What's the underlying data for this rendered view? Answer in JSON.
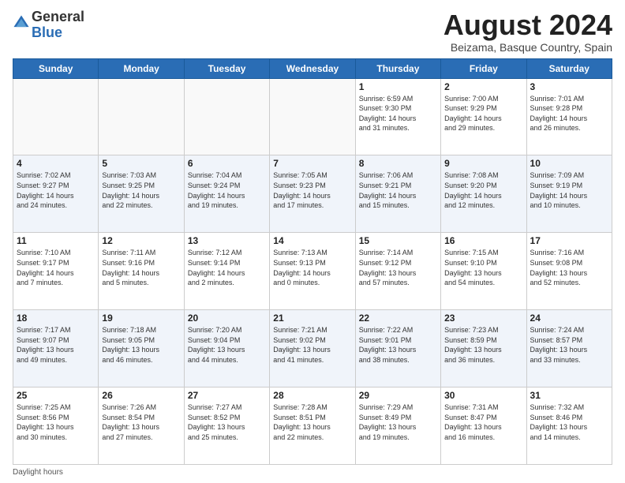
{
  "header": {
    "logo_general": "General",
    "logo_blue": "Blue",
    "month_year": "August 2024",
    "location": "Beizama, Basque Country, Spain"
  },
  "days_of_week": [
    "Sunday",
    "Monday",
    "Tuesday",
    "Wednesday",
    "Thursday",
    "Friday",
    "Saturday"
  ],
  "weeks": [
    [
      {
        "day": "",
        "info": ""
      },
      {
        "day": "",
        "info": ""
      },
      {
        "day": "",
        "info": ""
      },
      {
        "day": "",
        "info": ""
      },
      {
        "day": "1",
        "info": "Sunrise: 6:59 AM\nSunset: 9:30 PM\nDaylight: 14 hours\nand 31 minutes."
      },
      {
        "day": "2",
        "info": "Sunrise: 7:00 AM\nSunset: 9:29 PM\nDaylight: 14 hours\nand 29 minutes."
      },
      {
        "day": "3",
        "info": "Sunrise: 7:01 AM\nSunset: 9:28 PM\nDaylight: 14 hours\nand 26 minutes."
      }
    ],
    [
      {
        "day": "4",
        "info": "Sunrise: 7:02 AM\nSunset: 9:27 PM\nDaylight: 14 hours\nand 24 minutes."
      },
      {
        "day": "5",
        "info": "Sunrise: 7:03 AM\nSunset: 9:25 PM\nDaylight: 14 hours\nand 22 minutes."
      },
      {
        "day": "6",
        "info": "Sunrise: 7:04 AM\nSunset: 9:24 PM\nDaylight: 14 hours\nand 19 minutes."
      },
      {
        "day": "7",
        "info": "Sunrise: 7:05 AM\nSunset: 9:23 PM\nDaylight: 14 hours\nand 17 minutes."
      },
      {
        "day": "8",
        "info": "Sunrise: 7:06 AM\nSunset: 9:21 PM\nDaylight: 14 hours\nand 15 minutes."
      },
      {
        "day": "9",
        "info": "Sunrise: 7:08 AM\nSunset: 9:20 PM\nDaylight: 14 hours\nand 12 minutes."
      },
      {
        "day": "10",
        "info": "Sunrise: 7:09 AM\nSunset: 9:19 PM\nDaylight: 14 hours\nand 10 minutes."
      }
    ],
    [
      {
        "day": "11",
        "info": "Sunrise: 7:10 AM\nSunset: 9:17 PM\nDaylight: 14 hours\nand 7 minutes."
      },
      {
        "day": "12",
        "info": "Sunrise: 7:11 AM\nSunset: 9:16 PM\nDaylight: 14 hours\nand 5 minutes."
      },
      {
        "day": "13",
        "info": "Sunrise: 7:12 AM\nSunset: 9:14 PM\nDaylight: 14 hours\nand 2 minutes."
      },
      {
        "day": "14",
        "info": "Sunrise: 7:13 AM\nSunset: 9:13 PM\nDaylight: 14 hours\nand 0 minutes."
      },
      {
        "day": "15",
        "info": "Sunrise: 7:14 AM\nSunset: 9:12 PM\nDaylight: 13 hours\nand 57 minutes."
      },
      {
        "day": "16",
        "info": "Sunrise: 7:15 AM\nSunset: 9:10 PM\nDaylight: 13 hours\nand 54 minutes."
      },
      {
        "day": "17",
        "info": "Sunrise: 7:16 AM\nSunset: 9:08 PM\nDaylight: 13 hours\nand 52 minutes."
      }
    ],
    [
      {
        "day": "18",
        "info": "Sunrise: 7:17 AM\nSunset: 9:07 PM\nDaylight: 13 hours\nand 49 minutes."
      },
      {
        "day": "19",
        "info": "Sunrise: 7:18 AM\nSunset: 9:05 PM\nDaylight: 13 hours\nand 46 minutes."
      },
      {
        "day": "20",
        "info": "Sunrise: 7:20 AM\nSunset: 9:04 PM\nDaylight: 13 hours\nand 44 minutes."
      },
      {
        "day": "21",
        "info": "Sunrise: 7:21 AM\nSunset: 9:02 PM\nDaylight: 13 hours\nand 41 minutes."
      },
      {
        "day": "22",
        "info": "Sunrise: 7:22 AM\nSunset: 9:01 PM\nDaylight: 13 hours\nand 38 minutes."
      },
      {
        "day": "23",
        "info": "Sunrise: 7:23 AM\nSunset: 8:59 PM\nDaylight: 13 hours\nand 36 minutes."
      },
      {
        "day": "24",
        "info": "Sunrise: 7:24 AM\nSunset: 8:57 PM\nDaylight: 13 hours\nand 33 minutes."
      }
    ],
    [
      {
        "day": "25",
        "info": "Sunrise: 7:25 AM\nSunset: 8:56 PM\nDaylight: 13 hours\nand 30 minutes."
      },
      {
        "day": "26",
        "info": "Sunrise: 7:26 AM\nSunset: 8:54 PM\nDaylight: 13 hours\nand 27 minutes."
      },
      {
        "day": "27",
        "info": "Sunrise: 7:27 AM\nSunset: 8:52 PM\nDaylight: 13 hours\nand 25 minutes."
      },
      {
        "day": "28",
        "info": "Sunrise: 7:28 AM\nSunset: 8:51 PM\nDaylight: 13 hours\nand 22 minutes."
      },
      {
        "day": "29",
        "info": "Sunrise: 7:29 AM\nSunset: 8:49 PM\nDaylight: 13 hours\nand 19 minutes."
      },
      {
        "day": "30",
        "info": "Sunrise: 7:31 AM\nSunset: 8:47 PM\nDaylight: 13 hours\nand 16 minutes."
      },
      {
        "day": "31",
        "info": "Sunrise: 7:32 AM\nSunset: 8:46 PM\nDaylight: 13 hours\nand 14 minutes."
      }
    ]
  ],
  "footer": {
    "daylight_hours_label": "Daylight hours"
  }
}
